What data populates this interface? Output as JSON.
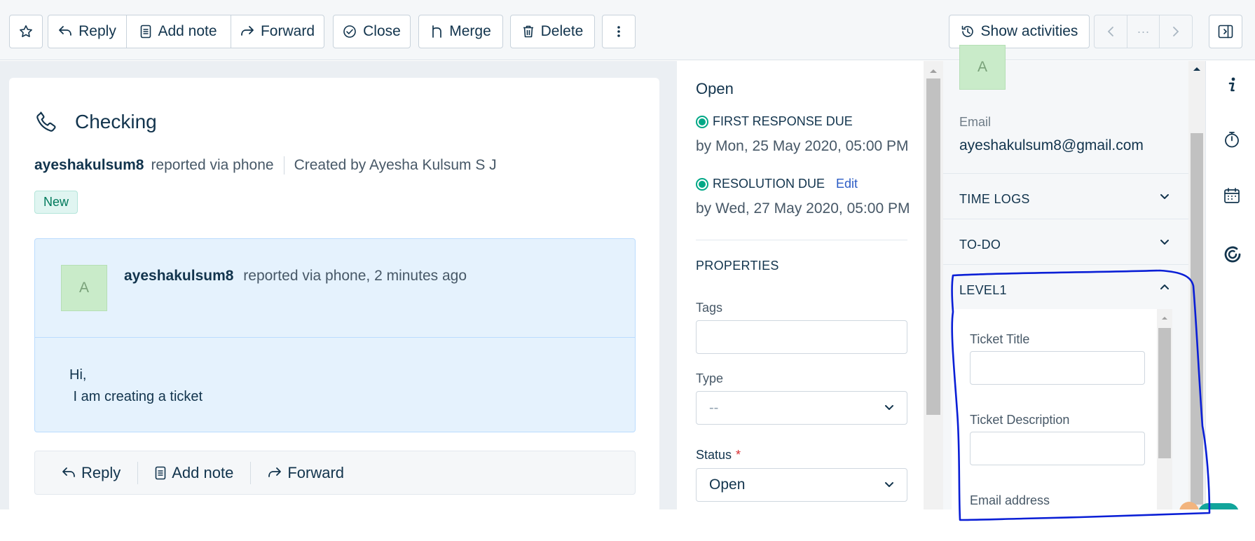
{
  "toolbar": {
    "reply": "Reply",
    "add_note": "Add note",
    "forward": "Forward",
    "close": "Close",
    "merge": "Merge",
    "delete": "Delete",
    "show_activities": "Show activities",
    "nav_middle": "···"
  },
  "ticket": {
    "title": "Checking",
    "requester": "ayeshakulsum8",
    "reported_via": "reported via phone",
    "created_by": "Created by Ayesha Kulsum S J",
    "status_badge": "New"
  },
  "conversation": {
    "avatar_initial": "A",
    "author": "ayeshakulsum8",
    "meta": "reported via phone, 2 minutes ago",
    "body_line1": "Hi,",
    "body_line2": " I am creating a ticket"
  },
  "reply_bar": {
    "reply": "Reply",
    "add_note": "Add note",
    "forward": "Forward"
  },
  "properties": {
    "status_text": "Open",
    "first_response_label": "FIRST RESPONSE DUE",
    "first_response_date": "by Mon, 25 May 2020, 05:00 PM",
    "resolution_label": "RESOLUTION DUE",
    "resolution_edit": "Edit",
    "resolution_date": "by Wed, 27 May 2020, 05:00 PM",
    "heading": "PROPERTIES",
    "tags_label": "Tags",
    "type_label": "Type",
    "type_value": "--",
    "status_label": "Status",
    "status_required": "*",
    "status_value": "Open"
  },
  "contact": {
    "avatar_initial": "A",
    "email_label": "Email",
    "email_value": "ayeshakulsum8@gmail.com",
    "time_logs": "TIME LOGS",
    "todo": "TO-DO",
    "level1": "LEVEL1",
    "level1_fields": {
      "ticket_title": "Ticket Title",
      "ticket_description": "Ticket Description",
      "email_address": "Email address"
    }
  },
  "colors": {
    "accent_green": "#00a886",
    "link_blue": "#2c5cc5",
    "annotation_blue": "#0a1fd6",
    "conversation_bg": "#e5f2fd"
  },
  "icons": {
    "star": "star-icon",
    "reply": "reply-icon",
    "note": "note-icon",
    "forward": "forward-icon",
    "close": "check-circle-icon",
    "merge": "merge-icon",
    "delete": "trash-icon",
    "more": "more-vertical-icon",
    "activities": "history-icon",
    "panel": "sidebar-toggle-icon",
    "phone": "phone-icon",
    "info": "info-icon",
    "timer": "stopwatch-icon",
    "calendar": "calendar-icon",
    "swirl": "app-swirl-icon"
  }
}
